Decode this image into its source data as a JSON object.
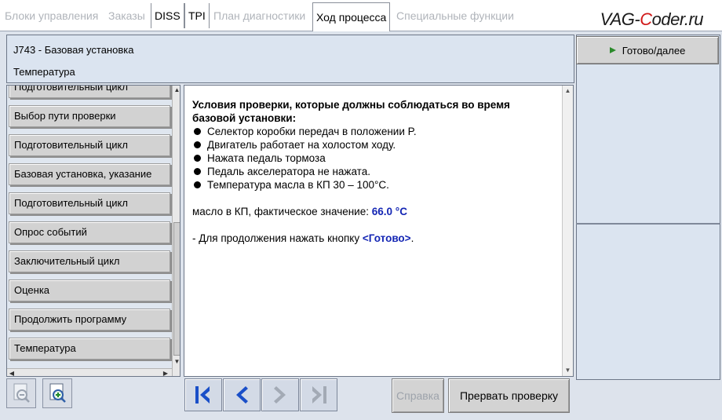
{
  "tabs": [
    {
      "label": "Блоки управления",
      "state": "disabled"
    },
    {
      "label": "Заказы",
      "state": "disabled"
    },
    {
      "label": "DISS",
      "state": "enabled"
    },
    {
      "label": "TPI",
      "state": "enabled"
    },
    {
      "label": "План диагностики",
      "state": "disabled"
    },
    {
      "label": "Ход процесса",
      "state": "active"
    },
    {
      "label": "Специальные функции",
      "state": "disabled"
    }
  ],
  "watermark": {
    "prefix": "VAG-",
    "accent": "C",
    "suffix": "oder.ru"
  },
  "header": {
    "title": "J743 - Базовая установка",
    "subtitle": "Температура"
  },
  "ready_button": {
    "label": "Готово/далее"
  },
  "steps": [
    {
      "label": "Подготовительный цикл"
    },
    {
      "label": "Выбор пути проверки"
    },
    {
      "label": "Подготовительный цикл"
    },
    {
      "label": "Базовая установка, указание"
    },
    {
      "label": "Подготовительный цикл"
    },
    {
      "label": "Опрос событий"
    },
    {
      "label": "Заключительный цикл"
    },
    {
      "label": "Оценка"
    },
    {
      "label": "Продолжить программу"
    },
    {
      "label": "Температура"
    }
  ],
  "info": {
    "title_line1": "Условия проверки, которые должны соблюдаться во время",
    "title_line2": "базовой установки:",
    "bullets": [
      "Селектор коробки передач в положении P.",
      "Двигатель работает на холостом ходу.",
      "Нажата педаль тормоза",
      "Педаль акселератора не нажата.",
      "Температура масла в КП 30 – 100°C."
    ],
    "measure_label": "масло в КП, фактическое значение:",
    "measure_value": "66.0 °C",
    "continue_text": "- Для продолжения нажать кнопку",
    "continue_button": "<Готово>",
    "continue_end": "."
  },
  "bottom": {
    "help_label": "Справка",
    "abort_label": "Прервать проверку"
  },
  "colors": {
    "accent_blue": "#1426b4",
    "nav_blue": "#1a4fc8",
    "watermark_red": "#d01818"
  },
  "icons": {
    "zoom_out": "zoom-out-icon",
    "zoom_in": "zoom-in-icon",
    "first": "first-icon",
    "prev": "prev-icon",
    "next": "next-icon",
    "last": "last-icon"
  }
}
